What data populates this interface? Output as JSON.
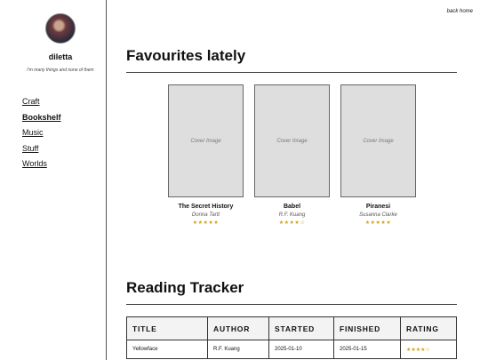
{
  "back_home": "back home",
  "sidebar": {
    "site_name": "diletta",
    "tagline": "I'm many things and none of them",
    "nav": [
      {
        "label": "Craft"
      },
      {
        "label": "Bookshelf"
      },
      {
        "label": "Music"
      },
      {
        "label": "Stuff"
      },
      {
        "label": "Worlds"
      }
    ]
  },
  "favourites": {
    "heading": "Favourites lately",
    "books": [
      {
        "cover_text": "Cover Image",
        "title": "The Secret History",
        "author": "Donna Tartt",
        "stars": "★★★★★",
        "rating": 5
      },
      {
        "cover_text": "Cover Image",
        "title": "Babel",
        "author": "R.F. Kuang",
        "stars": "★★★★☆",
        "rating": 4
      },
      {
        "cover_text": "Cover Image",
        "title": "Piranesi",
        "author": "Susanna Clarke",
        "stars": "★★★★★",
        "rating": 5
      }
    ]
  },
  "tracker": {
    "heading": "Reading Tracker",
    "columns": [
      "TITLE",
      "AUTHOR",
      "STARTED",
      "FINISHED",
      "RATING"
    ],
    "rows": [
      {
        "title": "Yellowface",
        "author": "R.F. Kuang",
        "started": "2025-01-10",
        "finished": "2025-01-15",
        "stars": "★★★★☆",
        "rating": 4
      }
    ]
  }
}
